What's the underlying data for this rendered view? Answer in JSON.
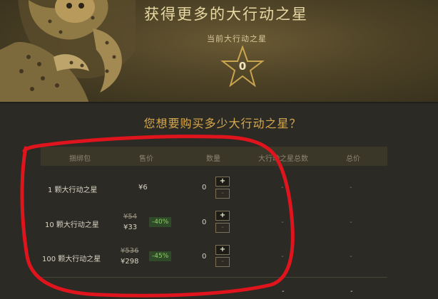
{
  "hero": {
    "title": "获得更多的大行动之星",
    "current_label": "当前大行动之星",
    "current_count": "0"
  },
  "question": "您想要购买多少大行动之星？",
  "table": {
    "headers": [
      "捆绑包",
      "售价",
      "数量",
      "大行动之星总数",
      "总价"
    ],
    "rows": [
      {
        "bundle": "1 颗大行动之星",
        "price": "¥6",
        "old_price": "",
        "discount": "",
        "qty": "0",
        "total_stars": "-",
        "total_price": "-"
      },
      {
        "bundle": "10 颗大行动之星",
        "price": "¥33",
        "old_price": "¥54",
        "discount": "-40%",
        "qty": "0",
        "total_stars": "-",
        "total_price": "-"
      },
      {
        "bundle": "100 颗大行动之星",
        "price": "¥298",
        "old_price": "¥536",
        "discount": "-45%",
        "qty": "0",
        "total_stars": "-",
        "total_price": "-"
      }
    ],
    "plus_label": "+",
    "minus_label": "-",
    "footer_total_stars": "-",
    "footer_total_price": "-"
  },
  "colors": {
    "accent": "#d8a84c",
    "discount_bg": "#2f4a26",
    "discount_text": "#8ed06a",
    "annotation": "#e0141c"
  },
  "icons": [
    "leopard-art",
    "star-icon",
    "plus-icon",
    "minus-icon"
  ]
}
